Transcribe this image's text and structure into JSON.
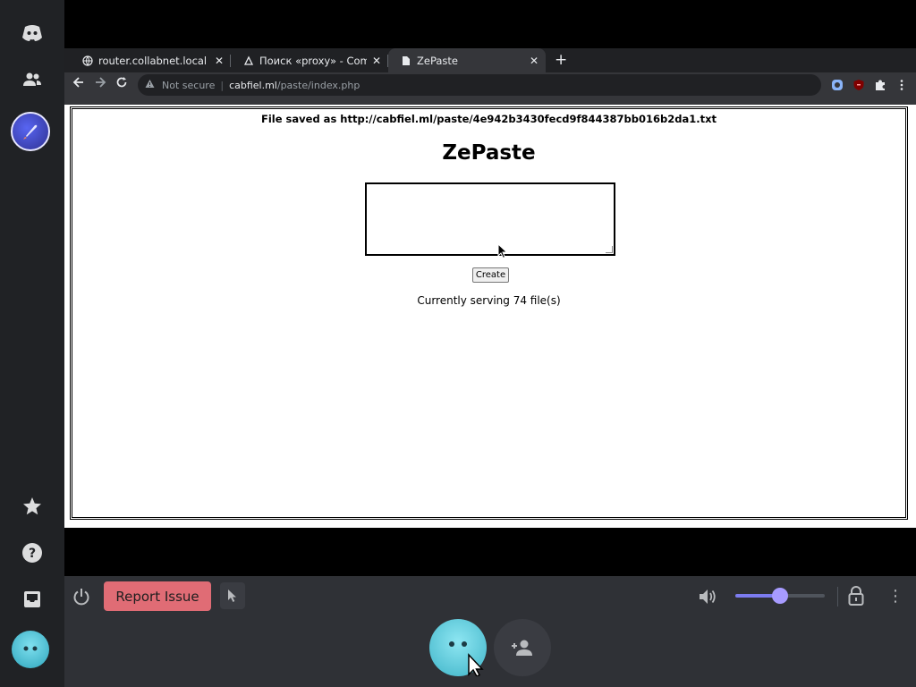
{
  "browser": {
    "tabs": [
      {
        "title": "router.collabnet.local",
        "icon": "globe-icon",
        "active": false
      },
      {
        "title": "Поиск «proxy» - Comput",
        "icon": "app-icon",
        "active": false
      },
      {
        "title": "ZePaste",
        "icon": "page-icon",
        "active": true
      }
    ],
    "address": {
      "security_label": "Not secure",
      "host": "cabfiel.ml",
      "path": "/paste/index.php"
    }
  },
  "page": {
    "saved_message": "File saved as http://cabfiel.ml/paste/4e942b3430fecd9f844387bb016b2da1.txt",
    "title": "ZePaste",
    "textarea_value": "",
    "create_button": "Create",
    "serving_text": "Currently serving 74 file(s)"
  },
  "controls": {
    "report_label": "Report Issue",
    "volume_level": 0.5,
    "colors": {
      "report": "#e06c75",
      "volume": "#a79bff",
      "rail": "#202225",
      "bar": "#2f3136"
    }
  }
}
